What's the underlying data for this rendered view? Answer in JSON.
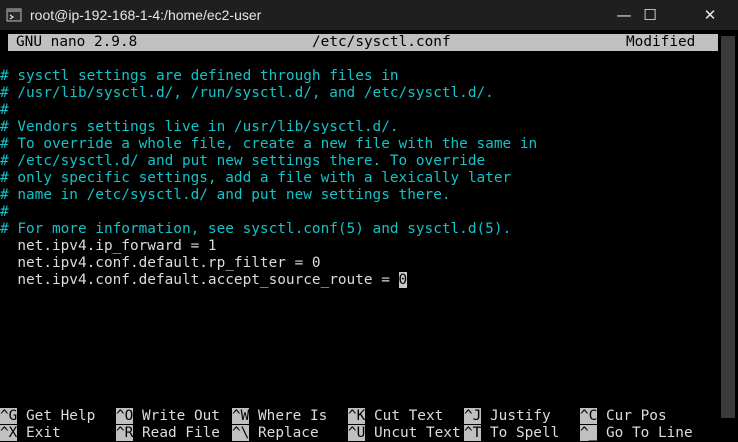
{
  "window": {
    "title": "root@ip-192-168-1-4:/home/ec2-user",
    "minimize_glyph": "—",
    "maximize_glyph": "☐",
    "close_glyph": "✕",
    "icon": "terminal-app-icon"
  },
  "nano": {
    "version": "GNU nano 2.9.8",
    "filename": "/etc/sysctl.conf",
    "state": "Modified"
  },
  "lines": [
    {
      "type": "comment",
      "text": "# sysctl settings are defined through files in"
    },
    {
      "type": "comment",
      "text": "# /usr/lib/sysctl.d/, /run/sysctl.d/, and /etc/sysctl.d/."
    },
    {
      "type": "comment",
      "text": "#"
    },
    {
      "type": "comment",
      "text": "# Vendors settings live in /usr/lib/sysctl.d/."
    },
    {
      "type": "comment",
      "text": "# To override a whole file, create a new file with the same in"
    },
    {
      "type": "comment",
      "text": "# /etc/sysctl.d/ and put new settings there. To override"
    },
    {
      "type": "comment",
      "text": "# only specific settings, add a file with a lexically later"
    },
    {
      "type": "comment",
      "text": "# name in /etc/sysctl.d/ and put new settings there."
    },
    {
      "type": "comment",
      "text": "#"
    },
    {
      "type": "comment",
      "text": "# For more information, see sysctl.conf(5) and sysctl.d(5)."
    },
    {
      "type": "code",
      "text": "  net.ipv4.ip_forward = 1"
    },
    {
      "type": "code",
      "text": "  net.ipv4.conf.default.rp_filter = 0"
    },
    {
      "type": "code",
      "text": "  net.ipv4.conf.default.accept_source_route = 0"
    }
  ],
  "shortcuts": [
    [
      {
        "key": "^G",
        "label": "Get Help"
      },
      {
        "key": "^O",
        "label": "Write Out"
      },
      {
        "key": "^W",
        "label": "Where Is"
      },
      {
        "key": "^K",
        "label": "Cut Text"
      },
      {
        "key": "^J",
        "label": "Justify"
      },
      {
        "key": "^C",
        "label": "Cur Pos"
      }
    ],
    [
      {
        "key": "^X",
        "label": "Exit"
      },
      {
        "key": "^R",
        "label": "Read File"
      },
      {
        "key": "^\\",
        "label": "Replace"
      },
      {
        "key": "^U",
        "label": "Uncut Text"
      },
      {
        "key": "^T",
        "label": "To Spell"
      },
      {
        "key": "^_",
        "label": "Go To Line"
      }
    ]
  ],
  "colors": {
    "comment": "#13c3c8",
    "text": "#dcdcdc",
    "header_bg": "#c0c0c0"
  }
}
